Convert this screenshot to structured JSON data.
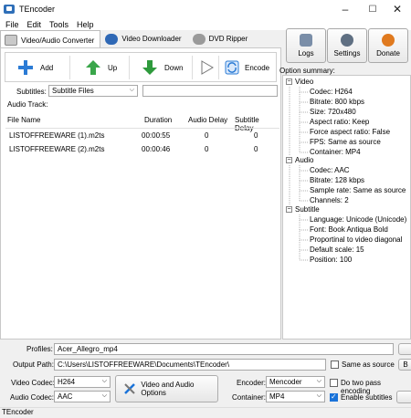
{
  "window": {
    "title": "TEncoder",
    "min": "–",
    "max": "☐",
    "close": "✕"
  },
  "menu": [
    "File",
    "Edit",
    "Tools",
    "Help"
  ],
  "tabs": [
    {
      "label": "Video/Audio Converter",
      "active": true
    },
    {
      "label": "Video Downloader",
      "active": false
    },
    {
      "label": "DVD Ripper",
      "active": false
    }
  ],
  "toolbar": {
    "add": "Add",
    "up": "Up",
    "down": "Down",
    "encode": "Encode"
  },
  "subtitles": {
    "label": "Subtitles:",
    "value": "Subtitle Files",
    "arrow": "⌵"
  },
  "audio_track": {
    "label": "Audio Track:"
  },
  "table": {
    "headers": [
      "File Name",
      "Duration",
      "Audio Delay",
      "Subtitle Delay"
    ],
    "rows": [
      [
        "LISTOFFREEWARE (1).m2ts",
        "00:00:55",
        "0",
        "0"
      ],
      [
        "LISTOFFREEWARE (2).m2ts",
        "00:00:46",
        "0",
        "0"
      ]
    ]
  },
  "right_buttons": {
    "logs": "Logs",
    "settings": "Settings",
    "donate": "Donate"
  },
  "option_summary": {
    "title": "Option summary:",
    "video": {
      "label": "Video",
      "items": [
        "Codec: H264",
        "Bitrate: 800 kbps",
        "Size: 720x480",
        "Aspect ratio: Keep",
        "Force aspect ratio: False",
        "FPS: Same as source",
        "Container: MP4"
      ]
    },
    "audio": {
      "label": "Audio",
      "items": [
        "Codec: AAC",
        "Bitrate: 128 kbps",
        "Sample rate: Same as source",
        "Channels: 2"
      ]
    },
    "subtitle": {
      "label": "Subtitle",
      "items": [
        "Language: Unicode (Unicode)",
        "Font: Book Antiqua Bold",
        "Proportinal to video diagonal",
        "Default scale: 15",
        "Position: 100"
      ]
    }
  },
  "bottom": {
    "profiles_label": "Profiles:",
    "profiles_value": "Acer_Allegro_mp4",
    "output_label": "Output Path:",
    "output_value": "C:\\Users\\LISTOFFREEWARE\\Documents\\TEncoder\\",
    "same_as_source": "Same as source",
    "browse_cut": "B",
    "video_codec_label": "Video Codec:",
    "video_codec": "H264",
    "audio_codec_label": "Audio Codec:",
    "audio_codec": "AAC",
    "va_options": "Video and Audio Options",
    "encoder_label": "Encoder:",
    "encoder": "Mencoder",
    "container_label": "Container:",
    "container": "MP4",
    "two_pass": "Do two pass encoding",
    "enable_subtitles": "Enable subtitles"
  },
  "status": "TEncoder",
  "colors": {
    "accent": "#1a73d9",
    "add_green": "#3aa64a",
    "down_green": "#2e9a3c",
    "encode_blue": "#2b7bd5"
  }
}
